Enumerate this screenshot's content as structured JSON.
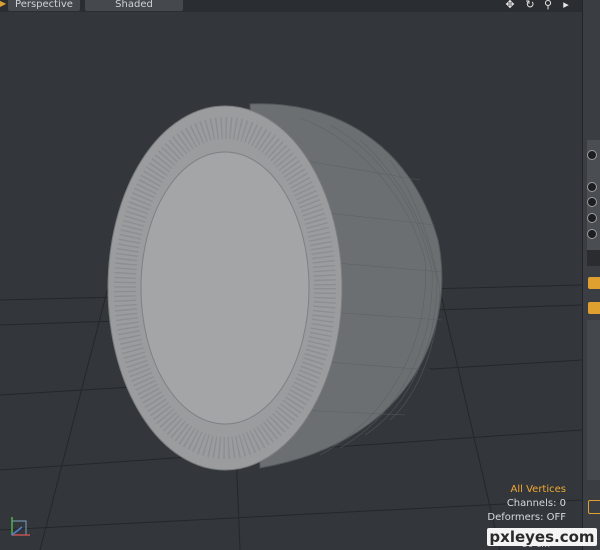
{
  "toolbar": {
    "view_mode": "Perspective",
    "shading_mode": "Shaded",
    "icons": [
      "move-view-icon",
      "orbit-icon",
      "zoom-icon",
      "expand-arrow-icon"
    ],
    "accent": "#e0a030"
  },
  "status": {
    "selection_mode": "All Vertices",
    "channels": "Channels: 0",
    "deformers": "Deformers: OFF",
    "grid_scale": "50 cm"
  },
  "watermark": {
    "text": "pxleyes.com"
  }
}
